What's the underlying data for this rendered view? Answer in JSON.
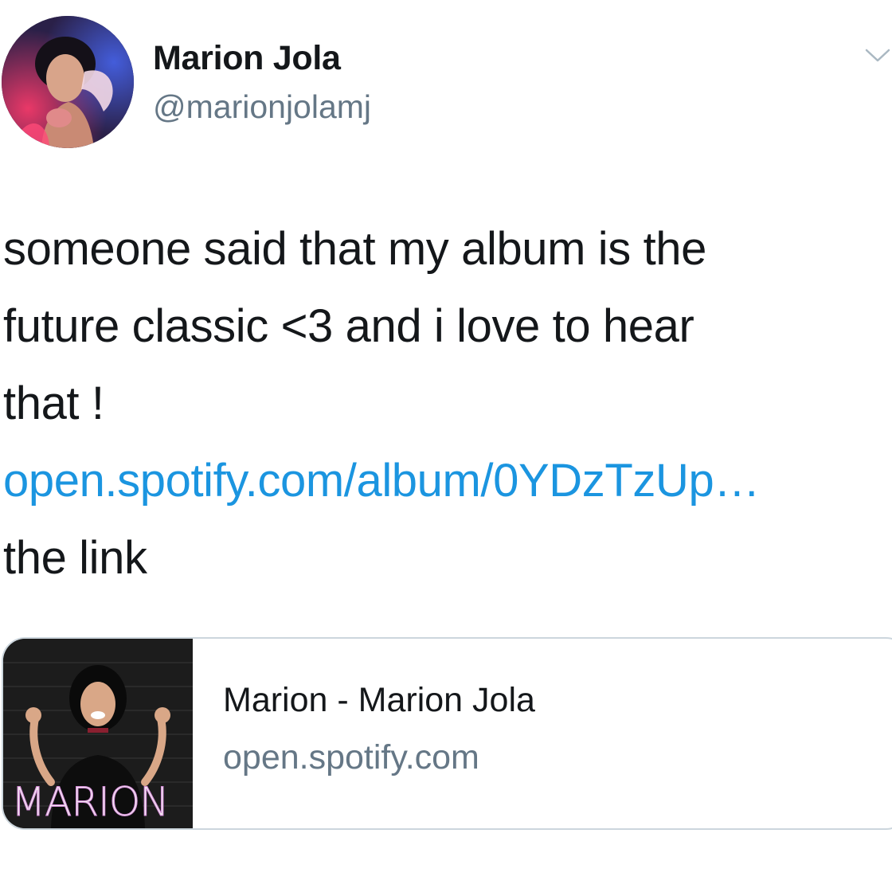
{
  "tweet": {
    "author": {
      "display_name": "Marion Jola",
      "handle": "@marionjolamj"
    },
    "menu_icon": "chevron-down-icon",
    "text_lines": [
      "someone said that my album is the",
      "future classic <3 and i love to hear",
      "that !"
    ],
    "link_text": "open.spotify.com/album/0YDzTzUp…",
    "trailing_text": "the link",
    "link_color": "#1b95e0"
  },
  "card": {
    "thumbnail_wordmark": "MARION",
    "title": "Marion - Marion Jola",
    "domain": "open.spotify.com"
  },
  "colors": {
    "text_primary": "#14171a",
    "text_secondary": "#657786",
    "card_border": "#ccd6dd"
  }
}
